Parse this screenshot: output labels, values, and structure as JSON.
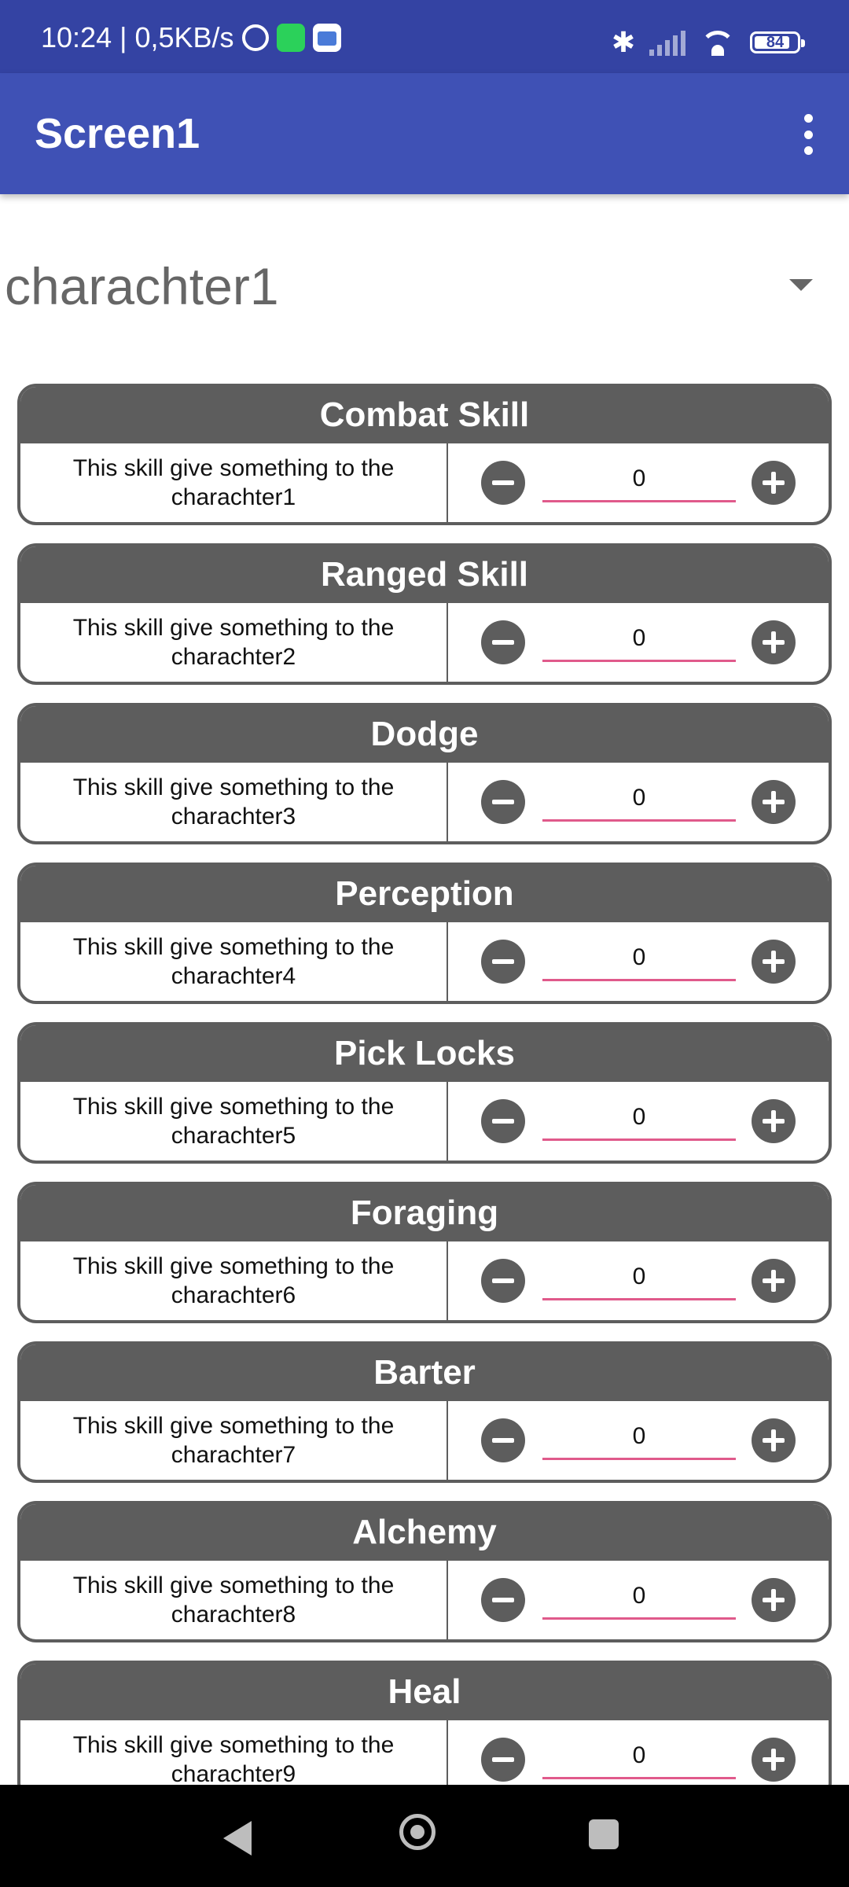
{
  "status_bar": {
    "time_and_speed": "10:24 | 0,5KB/s",
    "battery": "84",
    "icons": [
      "alarm-icon",
      "whatsapp-icon",
      "calendar-icon",
      "bluetooth-icon",
      "signal-icon",
      "wifi-icon",
      "battery-icon"
    ]
  },
  "app_bar": {
    "title": "Screen1",
    "menu_icon": "overflow-menu-icon"
  },
  "spinner": {
    "selected": "charachter1"
  },
  "skills": [
    {
      "name": "Combat Skill",
      "description": "This skill give something to the charachter1",
      "value": "0"
    },
    {
      "name": "Ranged Skill",
      "description": "This skill give something to the charachter2",
      "value": "0"
    },
    {
      "name": "Dodge",
      "description": "This skill give something to the charachter3",
      "value": "0"
    },
    {
      "name": "Perception",
      "description": "This skill give something to the charachter4",
      "value": "0"
    },
    {
      "name": "Pick Locks",
      "description": "This skill give something to the charachter5",
      "value": "0"
    },
    {
      "name": "Foraging",
      "description": "This skill give something to the charachter6",
      "value": "0"
    },
    {
      "name": "Barter",
      "description": "This skill give something to the charachter7",
      "value": "0"
    },
    {
      "name": "Alchemy",
      "description": "This skill give something to the charachter8",
      "value": "0"
    },
    {
      "name": "Heal",
      "description": "This skill give something to the charachter9",
      "value": "0"
    }
  ],
  "colors": {
    "status_bar": "#3443a3",
    "app_bar": "#3f51b5",
    "card": "#5d5d5d",
    "field_underline": "#e05a8b"
  }
}
